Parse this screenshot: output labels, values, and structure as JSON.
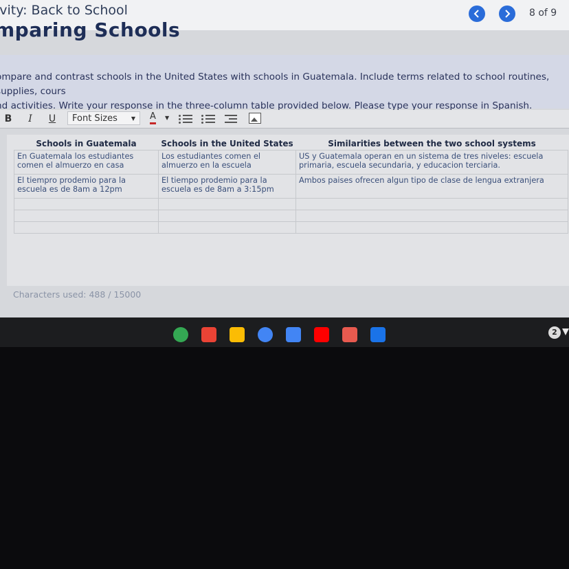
{
  "header": {
    "activity_title": "ivity: Back to School",
    "page_counter": "8 of 9",
    "prev_icon": "chevron-left-icon",
    "next_icon": "chevron-right-icon"
  },
  "title": "mparing Schools",
  "prompt": {
    "line1": "ompare and contrast schools in the United States with schools in Guatemala. Include terms related to school routines, supplies, cours",
    "line2": "nd activities. Write your response in the three-column table provided below. Please type your response in Spanish."
  },
  "toolbar": {
    "bold": "B",
    "italic": "I",
    "underline": "U",
    "font_sizes": "Font Sizes",
    "font_color": "A"
  },
  "table": {
    "headers": [
      "Schools in Guatemala",
      "Schools in the United States",
      "Similarities between the two school systems"
    ],
    "rows": [
      [
        "En Guatemala los estudiantes comen el almuerzo en casa",
        "Los estudiantes comen el almuerzo en la escuela",
        "US y Guatemala operan en un sistema de tres niveles: escuela primaria, escuela secundaria, y educacion terciaria."
      ],
      [
        "El tiempro prodemio para la escuela es de 8am a 12pm",
        "El tiempo prodemio para la escuela es de 8am a 3:15pm",
        "Ambos paises ofrecen algun tipo de clase de lengua extranjera"
      ],
      [
        "",
        "",
        ""
      ],
      [
        "",
        "",
        ""
      ],
      [
        "",
        "",
        ""
      ]
    ]
  },
  "characters": {
    "label": "Characters used:",
    "value": "488 / 15000"
  },
  "shelf": {
    "apps": [
      {
        "name": "drive-icon",
        "color": "#34a853"
      },
      {
        "name": "gmail-icon",
        "color": "#ea4335"
      },
      {
        "name": "google-drive-icon",
        "color": "#fbbc04"
      },
      {
        "name": "chrome-icon",
        "color": "#4285f4"
      },
      {
        "name": "docs-icon",
        "color": "#4285f4"
      },
      {
        "name": "youtube-icon",
        "color": "#ff0000"
      },
      {
        "name": "screencast-icon",
        "color": "#e85a4f"
      },
      {
        "name": "files-icon",
        "color": "#1a73e8"
      }
    ],
    "notification_count": "2"
  },
  "colors": {
    "accent": "#2a6cd9",
    "title": "#1e2e57",
    "prompt_bg": "#d4d8e6"
  }
}
